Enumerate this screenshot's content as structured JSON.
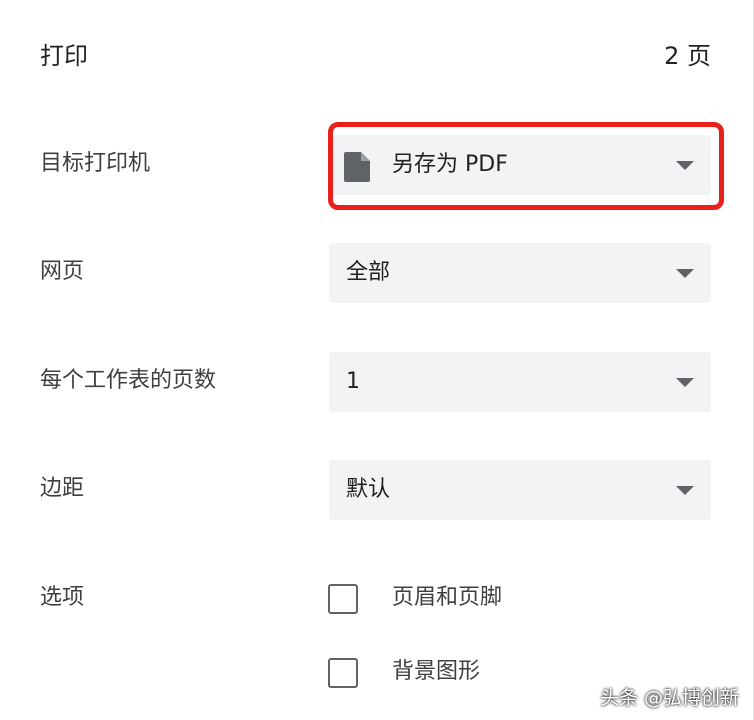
{
  "header": {
    "title": "打印",
    "page_count": "2 页"
  },
  "destination": {
    "label": "目标打印机",
    "value": "另存为 PDF",
    "icon": "document-icon"
  },
  "pages": {
    "label": "网页",
    "value": "全部"
  },
  "pages_per_sheet": {
    "label": "每个工作表的页数",
    "value": "1"
  },
  "margins": {
    "label": "边距",
    "value": "默认"
  },
  "options": {
    "label": "选项",
    "items": [
      {
        "label": "页眉和页脚",
        "checked": false
      },
      {
        "label": "背景图形",
        "checked": false
      }
    ]
  },
  "watermark": "头条 @弘博创新",
  "colors": {
    "highlight": "#e8211a",
    "select_bg": "#f1f3f4"
  }
}
